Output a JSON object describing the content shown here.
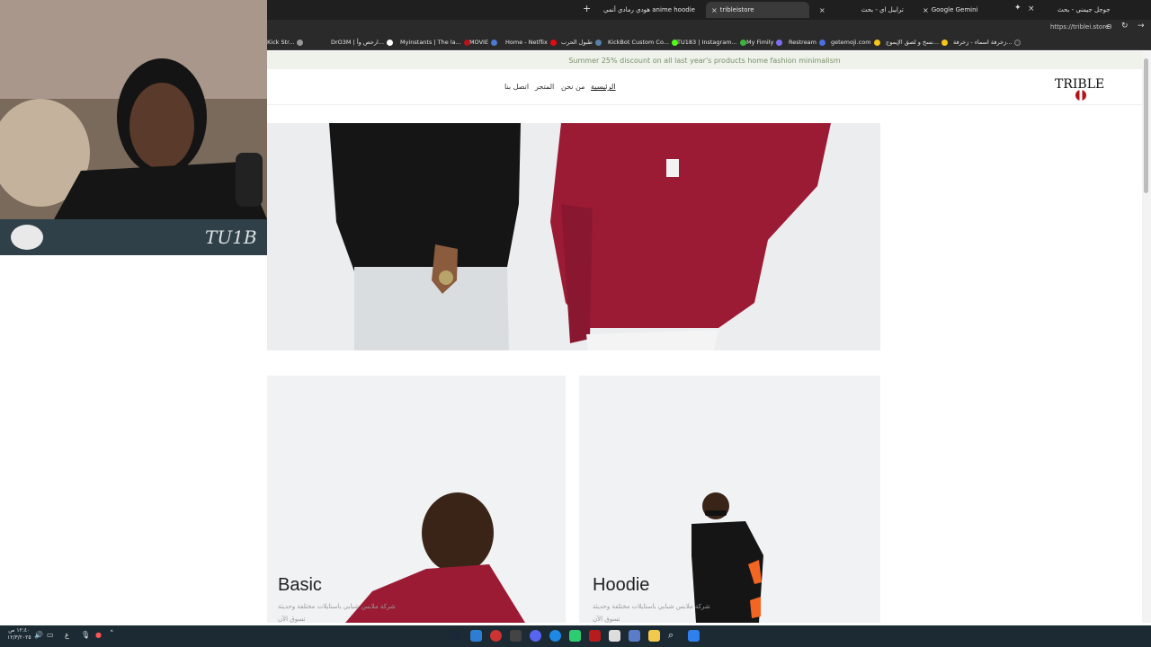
{
  "browser": {
    "tabs": [
      {
        "label": "جوجل جيمني - بحث",
        "active": false
      },
      {
        "label": "Google Gemini",
        "active": false
      },
      {
        "label": "ترايبل اي - بحث",
        "active": false
      },
      {
        "label": "tribleistore",
        "active": true
      },
      {
        "label": "هودي رمادي أنمي anime hoodie",
        "active": false
      }
    ],
    "url": "https://triblei.store",
    "bookmarks": [
      "Home - Netflix",
      "MOVIE",
      "Myinstants | The la...",
      "DrO3M | ارخص وأ...",
      "Kick Str...",
      "طبول الحرب",
      "KickBot Custom Co...",
      "TU183 | Instagram...",
      "My Fimily",
      "Restream",
      "getemoji.com",
      "نسخ و لصق الإيموج...",
      "زخرفة اسماء - زخرفة..."
    ]
  },
  "site": {
    "announcement": "Summer 25% discount on all last year's products home fashion minimalism",
    "logo": "TRIBLE",
    "nav": {
      "home": "الرئيسية",
      "about": "من نحن",
      "store": "المتجر",
      "contact": "اتصل بنا"
    },
    "categories": [
      {
        "title": "Basic",
        "subtitle": "شركة ملابس شبابي باستايلات مختلفة وحديثة",
        "link": "تسوق الآن"
      },
      {
        "title": "Hoodie",
        "subtitle": "شركة ملابس شبابي باستايلات مختلفة وحديثة",
        "link": "تسوق الآن"
      }
    ]
  },
  "webcam": {
    "banner_text": "TU1B"
  },
  "taskbar": {
    "time": "١٢:٤٠ ص",
    "date": "١٢/٣/٢٠٢٥",
    "lang": "ع"
  },
  "colors": {
    "hoodie_red": "#9c1b34",
    "hoodie_black": "#151515",
    "announce_bg": "#eef2ea",
    "announce_text": "#7b8f6a",
    "logo_red": "#b5121b"
  }
}
